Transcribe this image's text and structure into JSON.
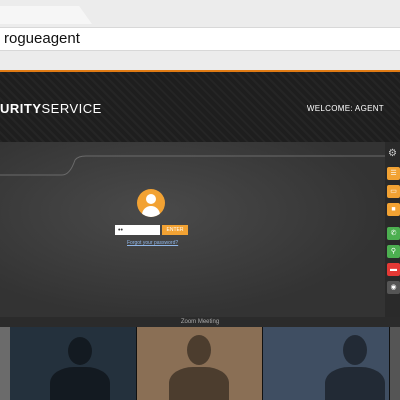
{
  "browser": {
    "address": "rogueagent"
  },
  "header": {
    "brand_partial": "URITY",
    "brand_rest": "SERVICE",
    "welcome": "WELCOME: AGENT"
  },
  "login": {
    "password_value": "••",
    "enter_label": "ENTER",
    "forgot_link": "Forgot your password?"
  },
  "side_buttons": [
    {
      "name": "list-icon",
      "color": "#f2a233",
      "glyph": "☰"
    },
    {
      "name": "monitor-icon",
      "color": "#f2a233",
      "glyph": "▭"
    },
    {
      "name": "camera-icon",
      "color": "#f2a233",
      "glyph": "■"
    },
    {
      "name": "phone-icon",
      "color": "#4caf50",
      "glyph": "✆"
    },
    {
      "name": "search-icon",
      "color": "#4caf50",
      "glyph": "⚲"
    },
    {
      "name": "car-icon",
      "color": "#e53935",
      "glyph": "▬"
    },
    {
      "name": "location-icon",
      "color": "#555555",
      "glyph": "◉"
    }
  ],
  "zoom": {
    "label": "Zoom Meeting"
  },
  "colors": {
    "accent": "#f2a233",
    "header_bg": "#1e1e1e"
  }
}
